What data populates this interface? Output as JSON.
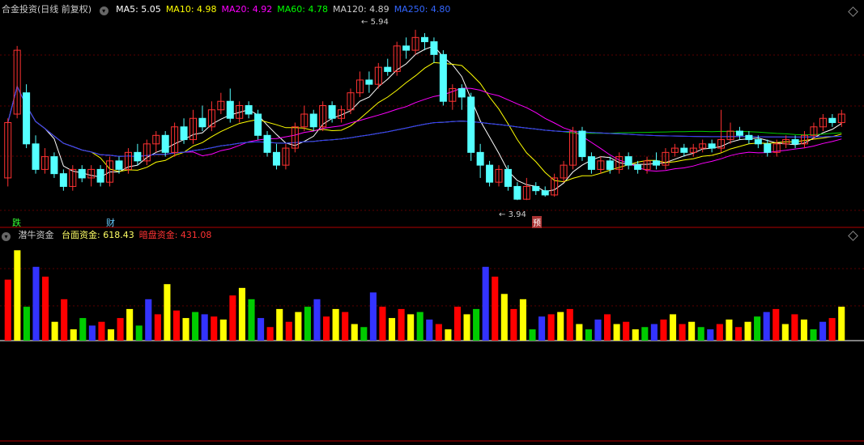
{
  "header_top": {
    "title": "合金投资(日线 前复权)",
    "ma": [
      {
        "label": "MA5: 5.05",
        "color": "#ffffff"
      },
      {
        "label": "MA10: 4.98",
        "color": "#ffff00"
      },
      {
        "label": "MA20: 4.92",
        "color": "#ff00ff"
      },
      {
        "label": "MA60: 4.78",
        "color": "#00ff00"
      },
      {
        "label": "MA120: 4.89",
        "color": "#cccccc"
      },
      {
        "label": "MA250: 4.80",
        "color": "#3366ff"
      }
    ]
  },
  "header_bottom": {
    "title": "潜牛资金",
    "items": [
      {
        "label": "台面资金: 618.43",
        "color": "#ffff66"
      },
      {
        "label": "暗盘资金: 431.08",
        "color": "#ff3333"
      }
    ]
  },
  "markers": {
    "fall_label": "跌",
    "fin_label": "财",
    "pred_label": "预",
    "high_label": "5.94",
    "low_label": "3.94"
  },
  "chart_data": [
    {
      "type": "candlestick",
      "title": "合金投资(日线 前复权)",
      "ylim": [
        3.8,
        6.1
      ],
      "price_high": 5.94,
      "price_low": 3.94,
      "candles": [
        [
          4.2,
          4.85,
          4.1,
          4.9
        ],
        [
          4.95,
          5.7,
          4.9,
          5.75
        ],
        [
          5.2,
          4.6,
          4.55,
          5.3
        ],
        [
          4.6,
          4.3,
          4.25,
          4.7
        ],
        [
          4.3,
          4.45,
          4.25,
          4.55
        ],
        [
          4.45,
          4.25,
          4.2,
          4.5
        ],
        [
          4.25,
          4.1,
          4.05,
          4.3
        ],
        [
          4.1,
          4.3,
          4.05,
          4.35
        ],
        [
          4.3,
          4.2,
          4.15,
          4.35
        ],
        [
          4.2,
          4.3,
          4.1,
          4.35
        ],
        [
          4.3,
          4.15,
          4.1,
          4.35
        ],
        [
          4.15,
          4.4,
          4.1,
          4.45
        ],
        [
          4.4,
          4.3,
          4.25,
          4.45
        ],
        [
          4.3,
          4.5,
          4.25,
          4.55
        ],
        [
          4.5,
          4.4,
          4.35,
          4.6
        ],
        [
          4.4,
          4.6,
          4.35,
          4.65
        ],
        [
          4.6,
          4.7,
          4.5,
          4.75
        ],
        [
          4.7,
          4.5,
          4.45,
          4.75
        ],
        [
          4.5,
          4.8,
          4.45,
          4.85
        ],
        [
          4.8,
          4.65,
          4.6,
          4.9
        ],
        [
          4.65,
          4.9,
          4.6,
          5.0
        ],
        [
          4.9,
          4.8,
          4.75,
          5.05
        ],
        [
          4.8,
          5.0,
          4.75,
          5.1
        ],
        [
          5.0,
          5.1,
          4.95,
          5.2
        ],
        [
          5.1,
          4.9,
          4.85,
          5.25
        ],
        [
          4.9,
          5.05,
          4.85,
          5.1
        ],
        [
          5.05,
          4.95,
          4.9,
          5.1
        ],
        [
          4.95,
          4.7,
          4.65,
          5.0
        ],
        [
          4.7,
          4.5,
          4.45,
          4.75
        ],
        [
          4.5,
          4.35,
          4.3,
          4.6
        ],
        [
          4.35,
          4.55,
          4.3,
          4.6
        ],
        [
          4.55,
          4.8,
          4.5,
          4.85
        ],
        [
          4.8,
          4.95,
          4.75,
          5.05
        ],
        [
          4.95,
          4.8,
          4.75,
          5.0
        ],
        [
          4.8,
          5.05,
          4.75,
          5.1
        ],
        [
          5.05,
          4.9,
          4.85,
          5.1
        ],
        [
          4.9,
          5.0,
          4.85,
          5.05
        ],
        [
          5.0,
          5.2,
          4.95,
          5.25
        ],
        [
          5.2,
          5.35,
          5.15,
          5.45
        ],
        [
          5.35,
          5.3,
          5.2,
          5.45
        ],
        [
          5.3,
          5.5,
          5.25,
          5.55
        ],
        [
          5.5,
          5.45,
          5.4,
          5.6
        ],
        [
          5.45,
          5.75,
          5.4,
          5.8
        ],
        [
          5.75,
          5.7,
          5.6,
          5.85
        ],
        [
          5.7,
          5.85,
          5.65,
          5.94
        ],
        [
          5.85,
          5.8,
          5.7,
          5.9
        ],
        [
          5.8,
          5.65,
          5.55,
          5.85
        ],
        [
          5.65,
          5.1,
          5.05,
          5.7
        ],
        [
          5.1,
          5.25,
          5.0,
          5.3
        ],
        [
          5.25,
          5.15,
          5.0,
          5.3
        ],
        [
          5.15,
          4.5,
          4.4,
          5.2
        ],
        [
          4.5,
          4.35,
          4.2,
          4.6
        ],
        [
          4.35,
          4.15,
          4.1,
          4.4
        ],
        [
          4.15,
          4.3,
          4.1,
          4.35
        ],
        [
          4.3,
          4.1,
          4.05,
          4.35
        ],
        [
          4.1,
          3.95,
          3.94,
          4.15
        ],
        [
          3.95,
          4.1,
          3.94,
          4.2
        ],
        [
          4.1,
          4.05,
          4.0,
          4.15
        ],
        [
          4.05,
          4.0,
          3.98,
          4.1
        ],
        [
          4.0,
          4.2,
          3.98,
          4.25
        ],
        [
          4.2,
          4.35,
          4.15,
          4.4
        ],
        [
          4.35,
          4.75,
          4.3,
          4.8
        ],
        [
          4.75,
          4.45,
          4.4,
          4.8
        ],
        [
          4.45,
          4.3,
          4.25,
          4.5
        ],
        [
          4.3,
          4.4,
          4.25,
          4.45
        ],
        [
          4.4,
          4.3,
          4.25,
          4.45
        ],
        [
          4.3,
          4.45,
          4.25,
          4.5
        ],
        [
          4.45,
          4.35,
          4.3,
          4.5
        ],
        [
          4.35,
          4.3,
          4.25,
          4.4
        ],
        [
          4.3,
          4.4,
          4.25,
          4.45
        ],
        [
          4.4,
          4.35,
          4.3,
          4.5
        ],
        [
          4.35,
          4.5,
          4.3,
          4.55
        ],
        [
          4.5,
          4.55,
          4.45,
          4.6
        ],
        [
          4.55,
          4.5,
          4.45,
          4.6
        ],
        [
          4.5,
          4.55,
          4.45,
          4.6
        ],
        [
          4.55,
          4.6,
          4.5,
          4.65
        ],
        [
          4.6,
          4.55,
          4.5,
          4.65
        ],
        [
          4.55,
          4.65,
          4.5,
          5.0
        ],
        [
          4.65,
          4.75,
          4.6,
          4.85
        ],
        [
          4.75,
          4.7,
          4.65,
          4.8
        ],
        [
          4.7,
          4.65,
          4.6,
          4.75
        ],
        [
          4.65,
          4.6,
          4.55,
          4.7
        ],
        [
          4.6,
          4.5,
          4.45,
          4.65
        ],
        [
          4.5,
          4.6,
          4.45,
          4.65
        ],
        [
          4.6,
          4.65,
          4.55,
          4.7
        ],
        [
          4.65,
          4.6,
          4.55,
          4.7
        ],
        [
          4.6,
          4.7,
          4.55,
          4.75
        ],
        [
          4.7,
          4.8,
          4.65,
          4.85
        ],
        [
          4.8,
          4.9,
          4.75,
          4.95
        ],
        [
          4.9,
          4.85,
          4.8,
          4.95
        ],
        [
          4.85,
          4.95,
          4.8,
          5.0
        ]
      ]
    },
    {
      "type": "bar",
      "title": "潜牛资金",
      "series": [
        {
          "name": "台面资金",
          "color": "#ffff00"
        },
        {
          "name": "暗盘资金",
          "color": "#ff0000"
        }
      ],
      "values": [
        81,
        120,
        45,
        98,
        85,
        25,
        55,
        15,
        30,
        20,
        25,
        15,
        30,
        42,
        20,
        55,
        35,
        75,
        40,
        30,
        38,
        35,
        32,
        28,
        60,
        70,
        55,
        30,
        18,
        42,
        25,
        38,
        45,
        55,
        32,
        42,
        38,
        22,
        18,
        64,
        45,
        30,
        42,
        35,
        38,
        28,
        22,
        15,
        45,
        35,
        42,
        98,
        85,
        62,
        42,
        55,
        15,
        32,
        35,
        38,
        42,
        22,
        15,
        28,
        35,
        22,
        25,
        15,
        18,
        22,
        28,
        35,
        22,
        25,
        18,
        15,
        22,
        28,
        18,
        25,
        32,
        38,
        42,
        22,
        35,
        28,
        15,
        25,
        30,
        45
      ]
    }
  ]
}
